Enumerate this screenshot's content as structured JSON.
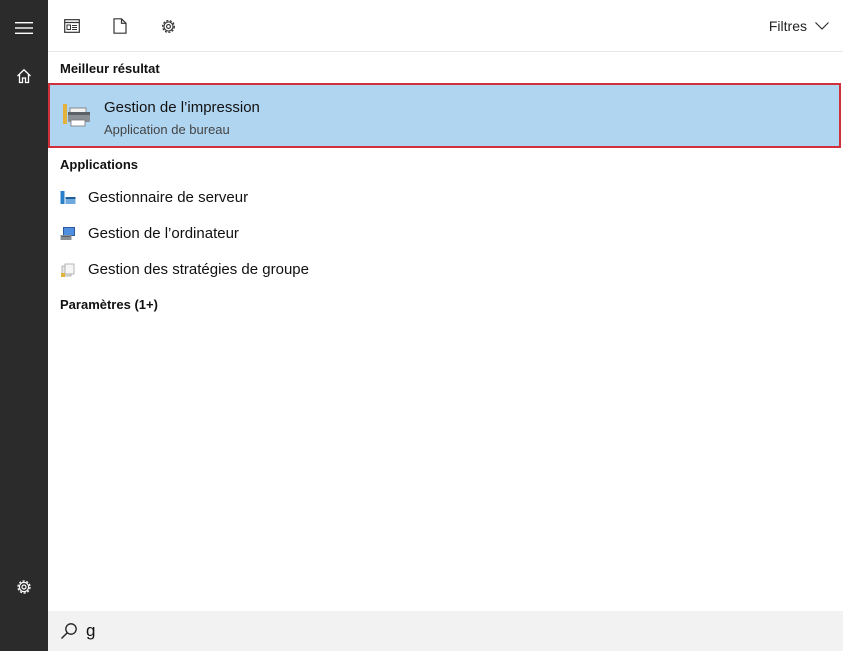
{
  "rail": {
    "items": [
      {
        "icon": "hamburger-menu-icon"
      },
      {
        "icon": "home-icon"
      },
      {
        "icon": "gear-icon"
      }
    ]
  },
  "toolbar": {
    "tabs": [
      {
        "icon": "apps-window-icon"
      },
      {
        "icon": "document-icon"
      },
      {
        "icon": "settings-gear-icon"
      }
    ],
    "filters_label": "Filtres"
  },
  "sections": {
    "best_header": "Meilleur résultat",
    "apps_header": "Applications",
    "settings_header": "Paramètres (1+)"
  },
  "best_result": {
    "title": "Gestion de l’impression",
    "subtitle": "Application de bureau",
    "icon": "printer-management-icon",
    "highlight_border": "#d0303b",
    "highlight_bg": "#b0d5f1"
  },
  "apps": [
    {
      "label": "Gestionnaire de serveur",
      "icon": "server-manager-icon"
    },
    {
      "label": "Gestion de l’ordinateur",
      "icon": "computer-management-icon"
    },
    {
      "label": "Gestion des stratégies de groupe",
      "icon": "group-policy-icon"
    }
  ],
  "search": {
    "value": "g",
    "icon": "search-icon"
  }
}
